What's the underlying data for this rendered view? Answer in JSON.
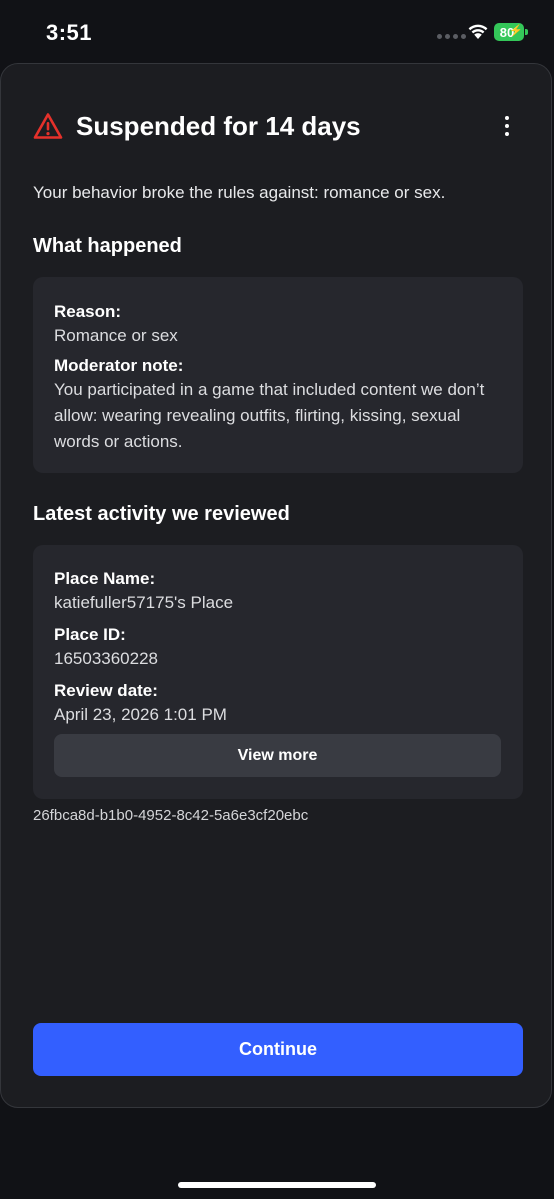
{
  "status_bar": {
    "time": "3:51",
    "battery_level": "80"
  },
  "header": {
    "title": "Suspended for 14 days",
    "warning_icon": "warning-triangle-icon",
    "menu_icon": "more-vertical-icon",
    "warning_color": "#e5312b"
  },
  "intro_text": "Your behavior broke the rules against: romance or sex.",
  "what_happened": {
    "heading": "What happened",
    "reason_label": "Reason:",
    "reason_value": "Romance or sex",
    "note_label": "Moderator note:",
    "note_value": "You participated in a game that included content we don’t allow: wearing revealing outfits, flirting, kissing, sexual words or actions."
  },
  "latest_activity": {
    "heading": "Latest activity we reviewed",
    "place_name_label": "Place Name:",
    "place_name_value": "katiefuller57175's Place",
    "place_id_label": "Place ID:",
    "place_id_value": "16503360228",
    "review_date_label": "Review date:",
    "review_date_value": "April 23, 2026 1:01 PM",
    "view_more_label": "View more"
  },
  "reference_id": "26fbca8d-b1b0-4952-8c42-5a6e3cf20ebc",
  "continue_label": "Continue",
  "colors": {
    "accent": "#335fff",
    "battery": "#34c759"
  }
}
